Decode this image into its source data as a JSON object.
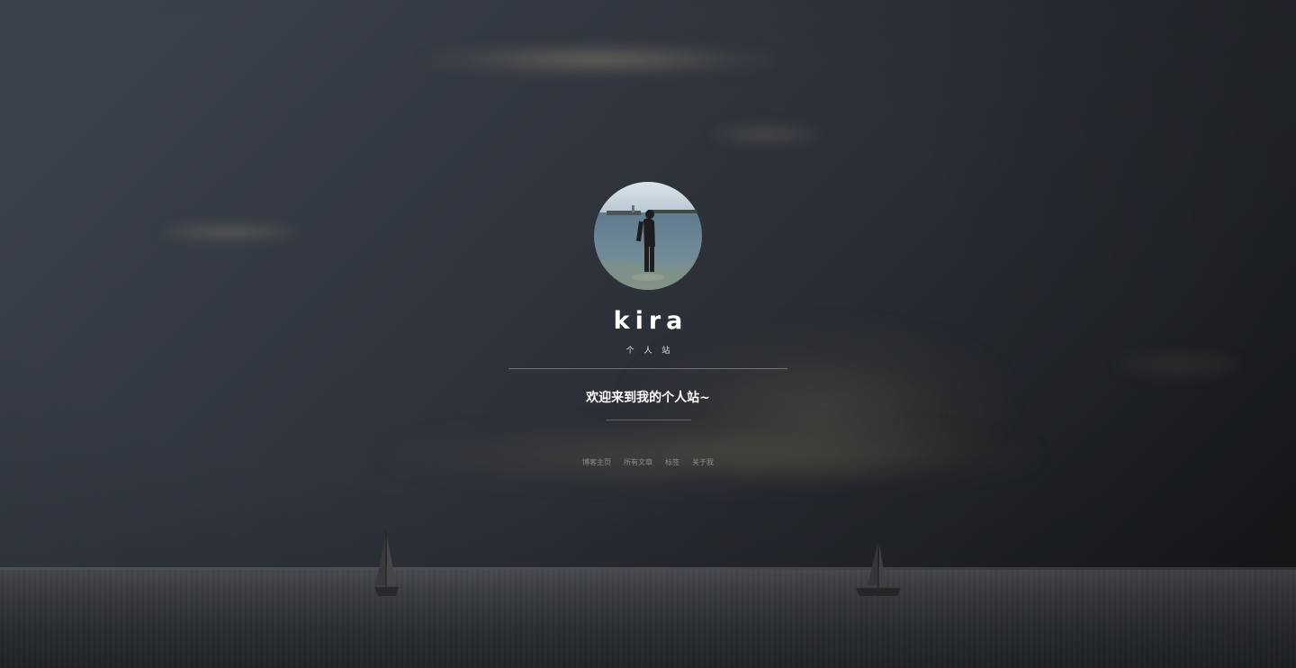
{
  "profile": {
    "name": "kira",
    "subtitle": "个 人 站",
    "welcome": "欢迎来到我的个人站~"
  },
  "nav": {
    "items": [
      {
        "label": "博客主页"
      },
      {
        "label": "所有文章"
      },
      {
        "label": "标签"
      },
      {
        "label": "关于我"
      }
    ]
  },
  "colors": {
    "background_top": "#3f4550",
    "background_bottom": "#16181b",
    "text_primary": "#ffffff",
    "nav_link": "#8a8d90"
  }
}
